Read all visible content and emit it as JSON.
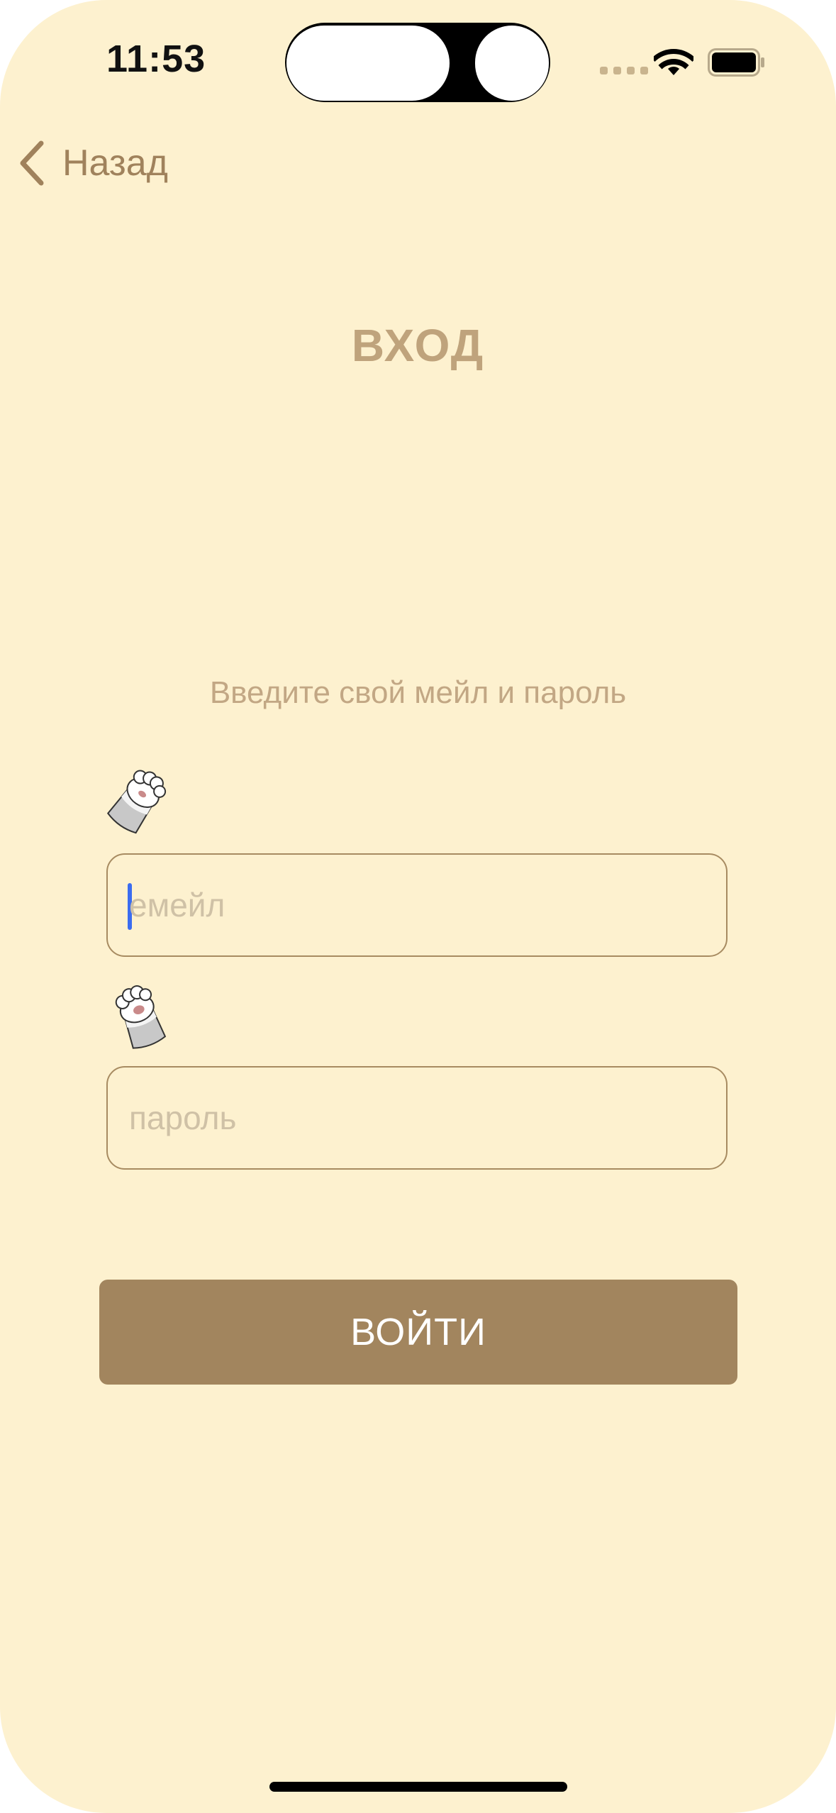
{
  "status_bar": {
    "time": "11:53",
    "wifi_icon": "wifi-icon",
    "battery_icon": "battery-icon"
  },
  "nav": {
    "back_label": "Назад",
    "back_icon": "chevron-left-icon"
  },
  "login": {
    "title": "ВХОД",
    "subtitle": "Введите свой мейл и пароль",
    "email_placeholder": "емейл",
    "password_placeholder": "пароль",
    "submit_label": "ВОЙТИ",
    "field_icon": "cat-paw-icon"
  },
  "colors": {
    "background": "#fdf1cf",
    "accent": "#a2855e",
    "title": "#bfa37c",
    "cursor": "#3b6cf0"
  }
}
